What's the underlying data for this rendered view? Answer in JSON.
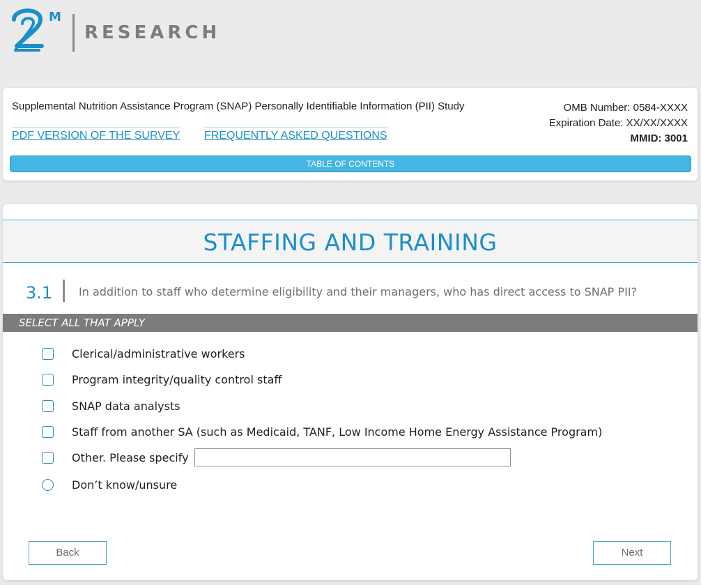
{
  "logo": {
    "mark": "2",
    "superscript": "M",
    "word": "RESEARCH",
    "mark_color": "#1b8fc9",
    "word_color": "#7d7d7d"
  },
  "header": {
    "study_title": "Supplemental Nutrition Assistance Program (SNAP) Personally Identifiable Information (PII) Study",
    "pdf_link": "PDF VERSION OF THE SURVEY",
    "faq_link": "FREQUENTLY ASKED QUESTIONS",
    "omb_number": "OMB Number: 0584-XXXX",
    "expiration": "Expiration Date: XX/XX/XXXX",
    "mmid": "MMID: 3001",
    "toc": "TABLE OF CONTENTS"
  },
  "section": {
    "title": "STAFFING AND TRAINING"
  },
  "question": {
    "number": "3.1",
    "text": "In addition to staff who determine eligibility and their managers, who has direct access to SNAP PII?",
    "instruction": "SELECT ALL THAT APPLY",
    "options": [
      {
        "label": "Clerical/administrative workers",
        "type": "checkbox",
        "checked": false
      },
      {
        "label": "Program integrity/quality control staff",
        "type": "checkbox",
        "checked": false
      },
      {
        "label": "SNAP data analysts",
        "type": "checkbox",
        "checked": false
      },
      {
        "label": "Staff from another SA (such as Medicaid, TANF, Low Income Home Energy Assistance Program)",
        "type": "checkbox",
        "checked": false
      },
      {
        "label": "Other. Please specify",
        "type": "checkbox",
        "checked": false
      },
      {
        "label": "Don’t know/unsure",
        "type": "radio",
        "checked": false
      }
    ],
    "other_value": ""
  },
  "nav": {
    "back": "Back",
    "next": "Next"
  },
  "colors": {
    "accent": "#1b8fc9",
    "toc_bar": "#45b6e3",
    "instruction_bar": "#7b7c7e",
    "background": "#ebebeb"
  }
}
